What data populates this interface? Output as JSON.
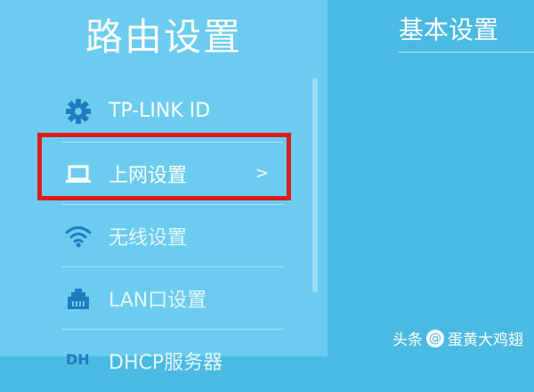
{
  "sidebar": {
    "title": "路由设置",
    "items": [
      {
        "label": "TP-LINK ID",
        "icon": "gear-icon"
      },
      {
        "label": "上网设置",
        "icon": "laptop-icon",
        "chevron": ">"
      },
      {
        "label": "无线设置",
        "icon": "wifi-icon"
      },
      {
        "label": "LAN口设置",
        "icon": "lan-port-icon"
      },
      {
        "label": "DHCP服务器",
        "icon": "dhcp-icon"
      }
    ]
  },
  "main": {
    "title": "基本设置"
  },
  "watermark": {
    "prefix": "头条",
    "at": "@",
    "author": "蛋黄大鸡翅"
  },
  "colors": {
    "sidebar_bg": "#6cccf0",
    "main_bg": "#4bbae2",
    "highlight_border": "#d91e1e",
    "icon": "#1f7cbf"
  }
}
